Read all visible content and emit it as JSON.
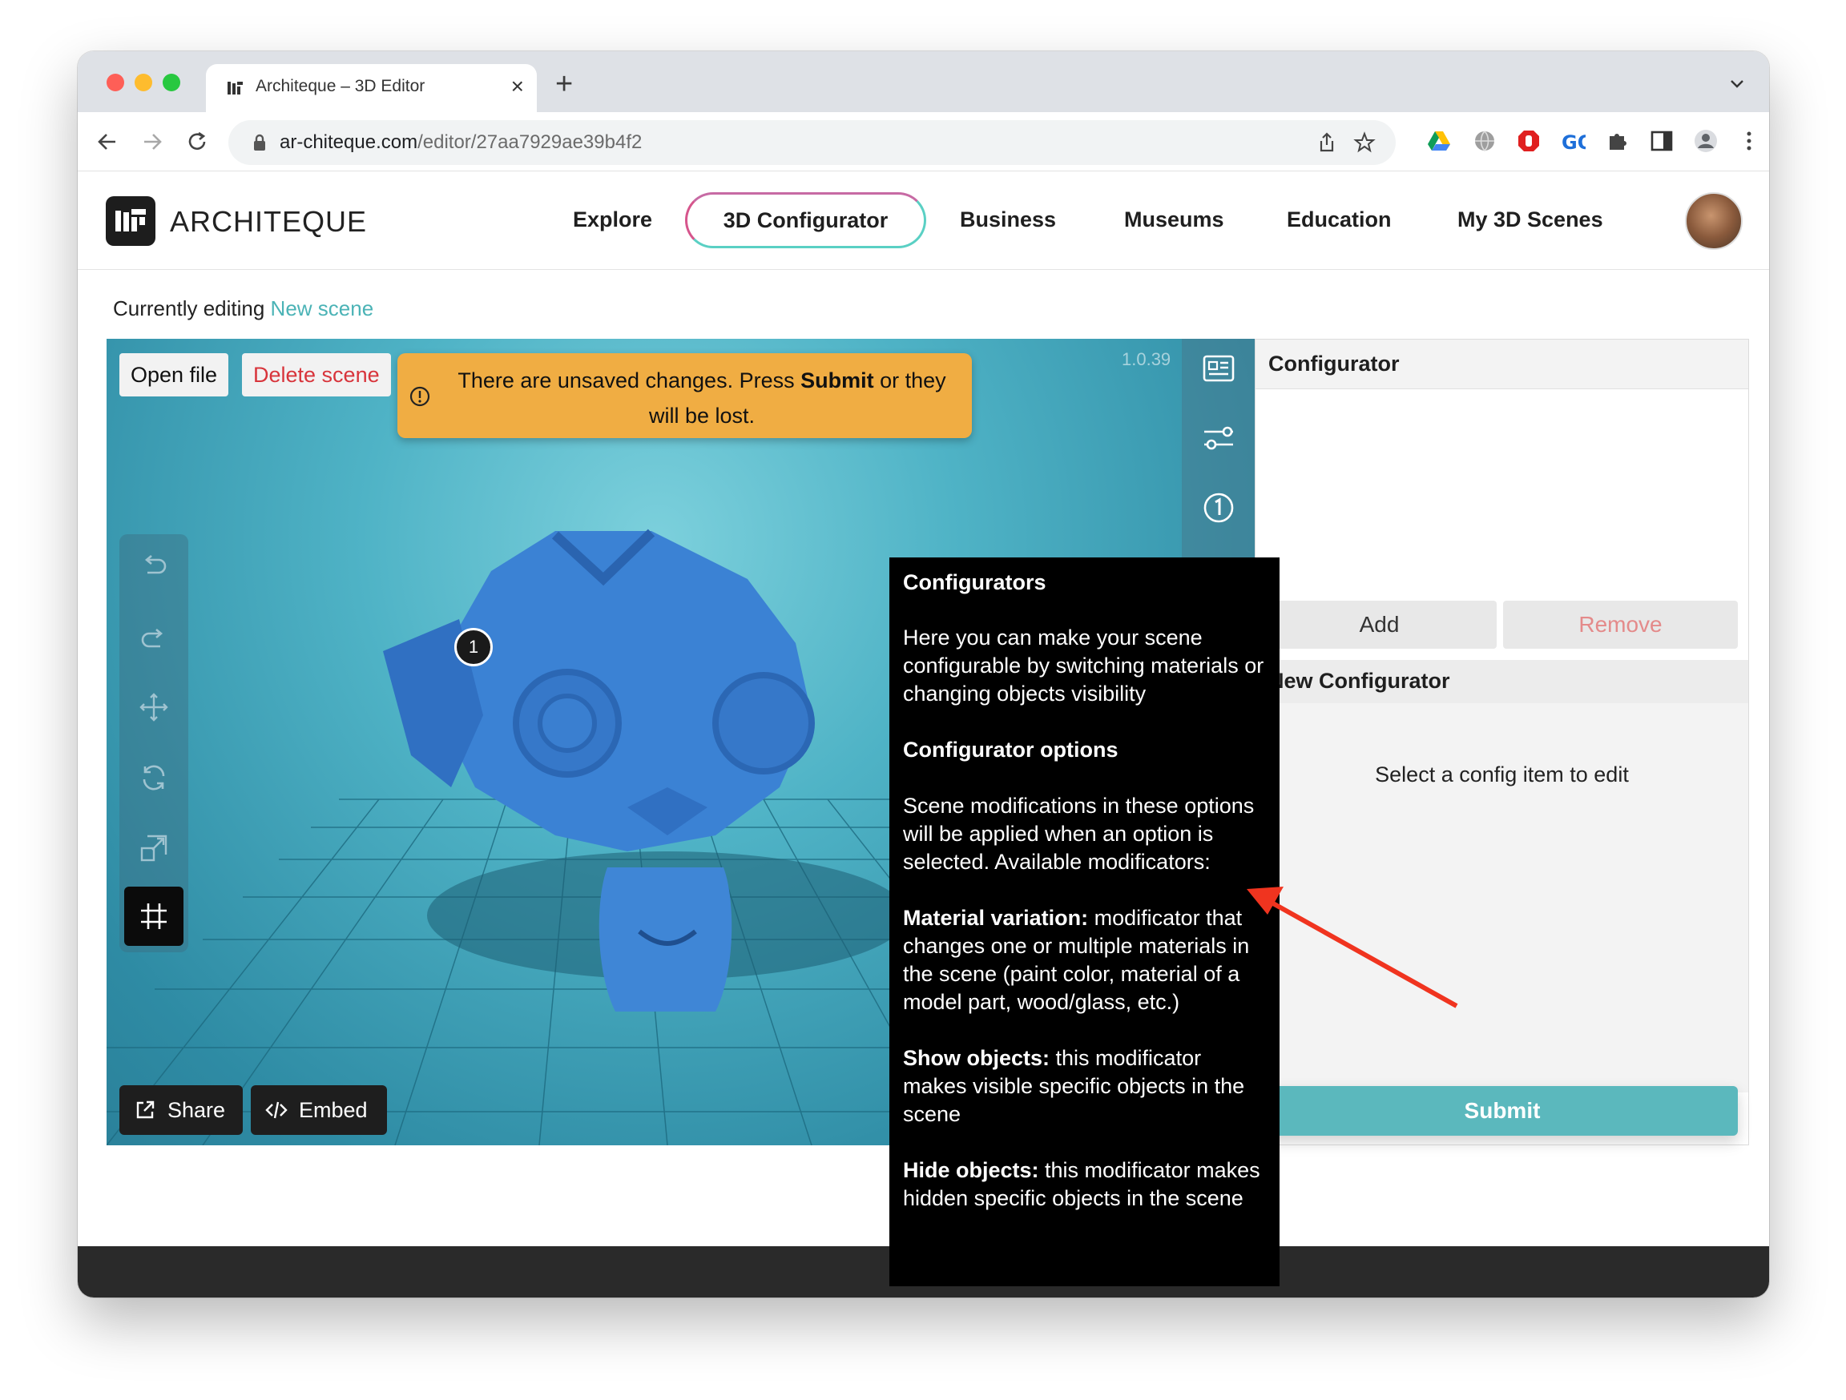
{
  "browser": {
    "tab_title": "Architeque – 3D Editor",
    "close_glyph": "×",
    "newtab_glyph": "+",
    "url_domain": "ar-chiteque.com",
    "url_path": "/editor/27aa7929ae39b4f2"
  },
  "header": {
    "logo": "ARCHITEQUE",
    "nav": {
      "explore": "Explore",
      "configurator": "3D Configurator",
      "business": "Business",
      "museums": "Museums",
      "education": "Education",
      "my_scenes": "My 3D Scenes"
    }
  },
  "editing": {
    "prefix": "Currently editing",
    "scene_name": "New scene"
  },
  "viewport": {
    "open_file": "Open file",
    "delete_scene": "Delete scene",
    "warning_before": "There are unsaved changes. Press ",
    "warning_bold": "Submit",
    "warning_after": " or they will be lost.",
    "version": "1.0.39",
    "marker": "1",
    "share": "Share",
    "embed": "Embed"
  },
  "tooltip": {
    "title": "Configurators",
    "intro": "Here you can make your scene configurable by switching materials or changing objects visibility",
    "options_title": "Configurator options",
    "options_text": "Scene modifications in these options will be applied when an option is selected. Available modificators:",
    "material_label": "Material variation:",
    "material_text": " modificator that changes one or multiple materials in the scene (paint color, material of a model part, wood/glass, etc.)",
    "show_label": "Show objects:",
    "show_text": " this modificator makes visible specific objects in the scene",
    "hide_label": "Hide objects:",
    "hide_text": " this modificator makes hidden specific objects in the scene"
  },
  "panel": {
    "title": "Configurator",
    "add": "Add",
    "remove": "Remove",
    "new_title": "New Configurator",
    "hint": "Select a config item to edit",
    "submit": "Submit"
  },
  "colors": {
    "accent_teal": "#5bb8bd",
    "warning": "#f0ad43",
    "danger": "#d8343b",
    "arrow": "#f0341f"
  },
  "icons": [
    "undo-icon",
    "redo-icon",
    "move-icon",
    "rotate-icon",
    "scale-icon",
    "grid-icon",
    "info-card-icon",
    "sliders-icon",
    "number-badge-icon",
    "hierarchy-icon",
    "texture-icon",
    "image-icon",
    "play-icon",
    "gear-icon",
    "fullscreen-icon",
    "share-icon",
    "embed-icon"
  ]
}
